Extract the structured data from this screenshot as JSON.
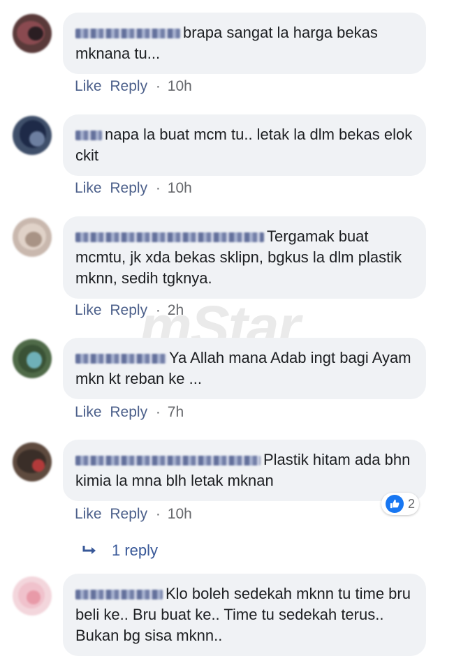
{
  "actions": {
    "like": "Like",
    "reply": "Reply",
    "separator": "·"
  },
  "comments": [
    {
      "text": "brapa sangat la harga bekas mknana tu...",
      "time": "10h"
    },
    {
      "text": "napa la buat mcm tu.. letak la dlm bekas elok ckit",
      "time": "10h"
    },
    {
      "text": "Tergamak buat mcmtu, jk xda bekas sklipn, bgkus la dlm plastik mknn, sedih tgknya.",
      "time": "2h"
    },
    {
      "text": "Ya Allah mana Adab ingt bagi Ayam mkn kt reban ke ...",
      "time": "7h"
    },
    {
      "text": "Plastik hitam ada bhn kimia la mna blh letak mknan",
      "time": "10h",
      "reaction_count": "2",
      "reaction_icon": "thumbs-up-icon"
    },
    {
      "text": "Klo boleh sedekah mknn tu time bru beli ke.. Bru buat ke.. Time tu sedekah terus.. Bukan bg sisa mknn.."
    }
  ],
  "replies_link": {
    "icon": "reply-arrow-icon",
    "label": "1 reply"
  },
  "watermark": "mStar",
  "colors": {
    "bubble": "#f0f2f5",
    "link": "#385898",
    "like_blue": "#1877f2"
  }
}
